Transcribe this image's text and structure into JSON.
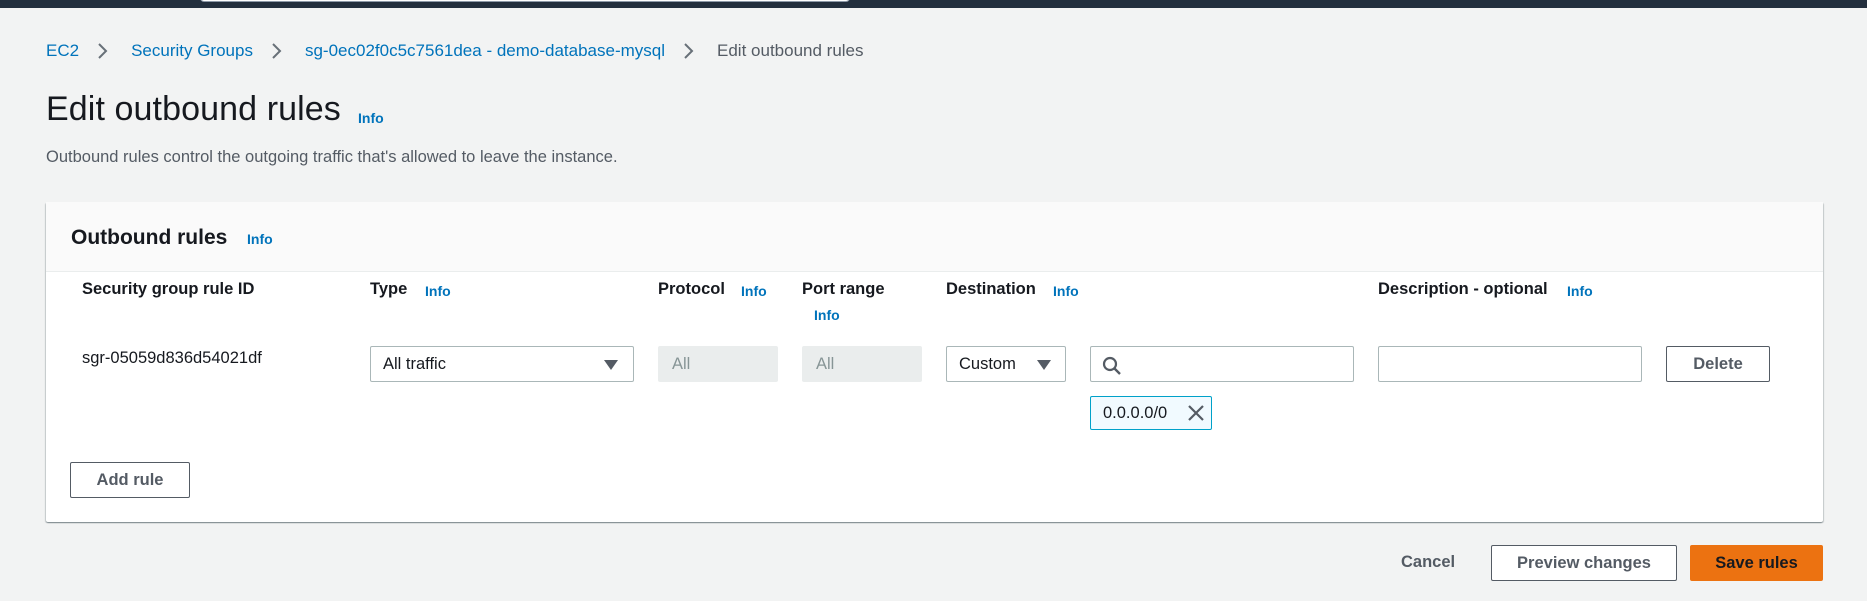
{
  "breadcrumb": {
    "items": [
      "EC2",
      "Security Groups",
      "sg-0ec02f0c5c7561dea - demo-database-mysql"
    ],
    "current": "Edit outbound rules"
  },
  "page": {
    "title": "Edit outbound rules",
    "info": "Info",
    "description": "Outbound rules control the outgoing traffic that's allowed to leave the instance."
  },
  "panel": {
    "title": "Outbound rules",
    "info": "Info",
    "columns": {
      "rule_id": "Security group rule ID",
      "type": "Type",
      "protocol": "Protocol",
      "port_range": "Port range",
      "destination": "Destination",
      "description": "Description - optional"
    },
    "info_label": "Info",
    "rule": {
      "id": "sgr-05059d836d54021df",
      "type": "All traffic",
      "protocol": "All",
      "port_range": "All",
      "destination_type": "Custom",
      "destination_search": "",
      "destination_token": "0.0.0.0/0",
      "description": "",
      "delete_label": "Delete"
    },
    "add_rule_label": "Add rule"
  },
  "footer": {
    "cancel": "Cancel",
    "preview": "Preview changes",
    "save": "Save rules"
  },
  "colors": {
    "link": "#0073bb",
    "primary": "#ec7211",
    "topbar": "#232f3e",
    "token_border": "#00a1c9"
  },
  "icons": [
    "chevron-right-icon",
    "caret-down-icon",
    "search-icon",
    "close-icon"
  ]
}
